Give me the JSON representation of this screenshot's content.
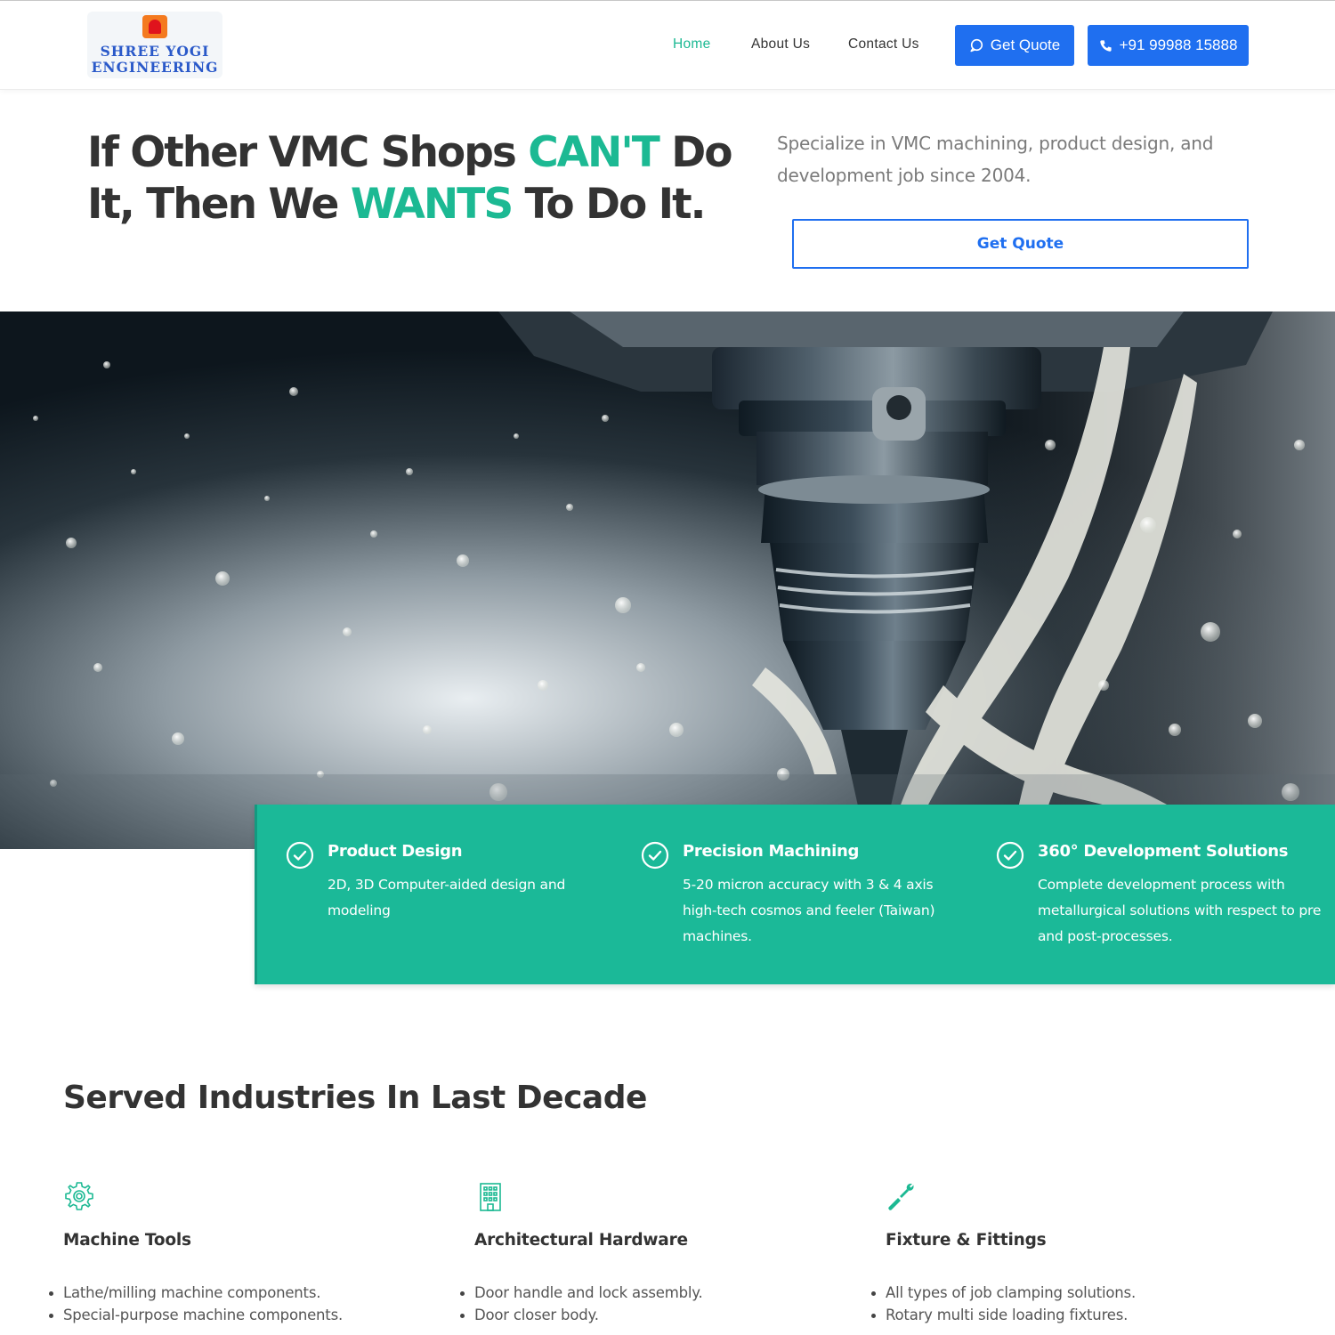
{
  "header": {
    "logo_text_line1": "SHREE YOGI",
    "logo_text_line2": "ENGINEERING",
    "nav": [
      {
        "label": "Home",
        "active": true
      },
      {
        "label": "About Us",
        "active": false
      },
      {
        "label": "Contact Us",
        "active": false
      }
    ],
    "quote_button_label": "Get Quote",
    "phone_button_label": "+91 99988 15888",
    "button_icons": [
      "chat-icon",
      "phone-icon"
    ]
  },
  "hero": {
    "title_part1": "If Other VMC Shops ",
    "title_accent1": "CAN'T",
    "title_part2": " Do It, Then We ",
    "title_accent2": "WANTS",
    "title_part3": " To Do It.",
    "subtitle": "Specialize in VMC machining, product design, and development job since 2004.",
    "cta_label": "Get Quote"
  },
  "features": [
    {
      "title": "Product Design",
      "text": "2D, 3D Computer-aided design and modeling",
      "icon": "check-circle-icon"
    },
    {
      "title": "Precision Machining",
      "text": "5-20 micron accuracy with 3 & 4 axis high-tech cosmos and feeler (Taiwan) machines.",
      "icon": "check-circle-icon"
    },
    {
      "title": "360° Development Solutions",
      "text": "Complete development process with metallurgical solutions with respect to pre and post-processes.",
      "icon": "check-circle-icon"
    }
  ],
  "industries": {
    "title": "Served Industries In Last Decade",
    "items": [
      {
        "name": "Machine Tools",
        "icon": "gear-icon",
        "bullets": [
          "Lathe/milling machine components.",
          "Special-purpose machine components."
        ]
      },
      {
        "name": "Architectural Hardware",
        "icon": "building-icon",
        "bullets": [
          "Door handle and lock assembly.",
          "Door closer body."
        ]
      },
      {
        "name": "Fixture & Fittings",
        "icon": "wrench-icon",
        "bullets": [
          "All types of job clamping solutions.",
          "Rotary multi side loading fixtures."
        ]
      }
    ]
  },
  "colors": {
    "accent_green": "#1cb993",
    "brand_blue": "#1f6ff0",
    "feature_band": "#1bb998",
    "text_dark": "#333333"
  }
}
